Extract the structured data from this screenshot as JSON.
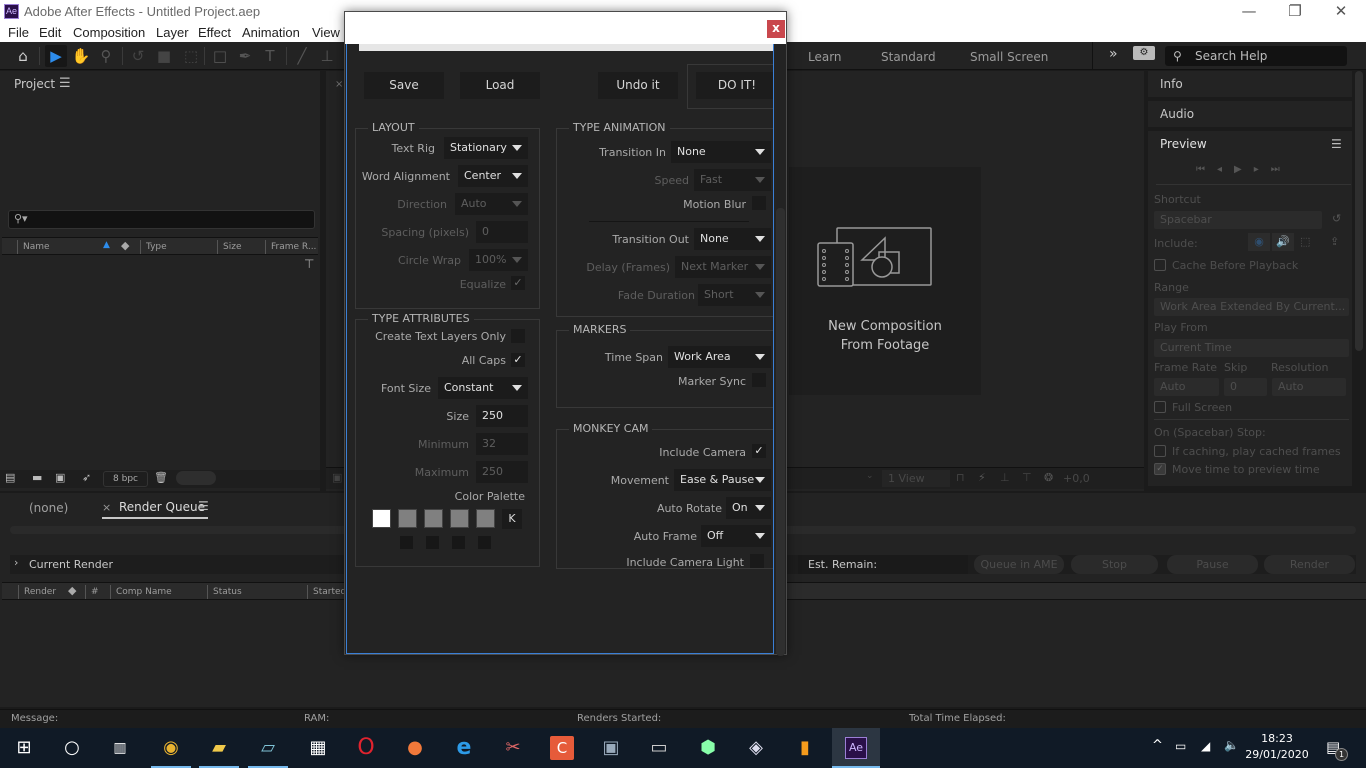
{
  "window": {
    "app_icon": "Ae",
    "title": "Adobe After Effects - Untitled Project.aep",
    "controls": {
      "minimize": "—",
      "restore": "❐",
      "close": "✕"
    }
  },
  "menu": [
    "File",
    "Edit",
    "Composition",
    "Layer",
    "Effect",
    "Animation",
    "View"
  ],
  "toolbar": {
    "tools": [
      "home-icon",
      "selection-icon",
      "hand-icon",
      "zoom-icon",
      "rotate-icon",
      "camera-icon",
      "pan-behind-icon",
      "rectangle-icon",
      "pen-icon",
      "type-icon",
      "brush-icon",
      "stamp-icon"
    ],
    "workspaces": [
      "Learn",
      "Standard",
      "Small Screen"
    ],
    "more": "»",
    "search_help": "Search Help"
  },
  "project_panel": {
    "title": "Project",
    "columns": [
      "Name",
      "Type",
      "Size",
      "Frame R..."
    ],
    "bpc": "8 bpc"
  },
  "composition_panel": {
    "new_comp_label_line1": "New Composition",
    "new_comp_label_line2": "From Footage",
    "view_select": "1 View",
    "exposure": "+0,0"
  },
  "right_panels": {
    "info": "Info",
    "audio": "Audio",
    "preview": {
      "title": "Preview",
      "shortcut_label": "Shortcut",
      "shortcut_value": "Spacebar",
      "include_label": "Include:",
      "cache_before_playback": "Cache Before Playback",
      "range_label": "Range",
      "range_value": "Work Area Extended By Current...",
      "play_from_label": "Play From",
      "play_from_value": "Current Time",
      "frame_rate_label": "Frame Rate",
      "frame_rate_value": "Auto",
      "skip_label": "Skip",
      "skip_value": "0",
      "resolution_label": "Resolution",
      "resolution_value": "Auto",
      "full_screen": "Full Screen",
      "on_stop_label": "On (Spacebar) Stop:",
      "if_caching": "If caching, play cached frames",
      "move_time": "Move time to preview time",
      "move_time_checked": true
    }
  },
  "render_queue": {
    "tab_none": "(none)",
    "tab_close": "×",
    "tab_title": "Render Queue",
    "current_render": "Current Render",
    "est_remain": "Est. Remain:",
    "buttons": [
      "Queue in AME",
      "Stop",
      "Pause",
      "Render"
    ],
    "columns": [
      "Render",
      "#",
      "Comp Name",
      "Status",
      "Started"
    ]
  },
  "status_bar": {
    "message": "Message:",
    "ram": "RAM:",
    "renders_started": "Renders Started:",
    "total_time": "Total Time Elapsed:"
  },
  "dialog": {
    "close": "x",
    "buttons": {
      "save": "Save",
      "load": "Load",
      "undo": "Undo it",
      "do_it": "DO IT!"
    },
    "layout": {
      "title": "LAYOUT",
      "text_rig_label": "Text Rig",
      "text_rig": "Stationary",
      "word_alignment_label": "Word Alignment",
      "word_alignment": "Center",
      "direction_label": "Direction",
      "direction": "Auto",
      "spacing_label": "Spacing (pixels)",
      "spacing": "0",
      "circle_wrap_label": "Circle Wrap",
      "circle_wrap": "100%",
      "equalize_label": "Equalize",
      "equalize": true
    },
    "type_attributes": {
      "title": "TYPE ATTRIBUTES",
      "create_text_layers_only_label": "Create Text Layers Only",
      "create_text_layers_only": false,
      "all_caps_label": "All Caps",
      "all_caps": true,
      "font_size_label": "Font Size",
      "font_size": "Constant",
      "size_label": "Size",
      "size": "250",
      "minimum_label": "Minimum",
      "minimum": "32",
      "maximum_label": "Maximum",
      "maximum": "250",
      "color_palette_label": "Color Palette",
      "palette": [
        "#ffffff",
        "#808080",
        "#808080",
        "#808080",
        "#808080"
      ],
      "palette_k": "K"
    },
    "type_animation": {
      "title": "TYPE ANIMATION",
      "transition_in_label": "Transition In",
      "transition_in": "None",
      "speed_label": "Speed",
      "speed": "Fast",
      "motion_blur_label": "Motion Blur",
      "motion_blur": false,
      "transition_out_label": "Transition Out",
      "transition_out": "None",
      "delay_label": "Delay (Frames)",
      "delay": "Next Marker",
      "fade_duration_label": "Fade Duration",
      "fade_duration": "Short"
    },
    "markers": {
      "title": "MARKERS",
      "time_span_label": "Time Span",
      "time_span": "Work Area",
      "marker_sync_label": "Marker Sync",
      "marker_sync": false
    },
    "monkey_cam": {
      "title": "MONKEY CAM",
      "include_camera_label": "Include Camera",
      "include_camera": true,
      "movement_label": "Movement",
      "movement": "Ease & Pause",
      "auto_rotate_label": "Auto Rotate",
      "auto_rotate": "On",
      "auto_frame_label": "Auto Frame",
      "auto_frame": "Off",
      "include_camera_light_label": "Include Camera Light",
      "include_camera_light": false
    }
  },
  "taskbar": {
    "apps": [
      "start-icon",
      "cortana-icon",
      "task-view-icon",
      "chrome-icon",
      "file-explorer-icon",
      "notes-icon",
      "calculator-icon",
      "opera-icon",
      "firefox-icon",
      "edge-icon",
      "snipping-icon",
      "camtasia-icon",
      "photos-icon",
      "monitor-icon",
      "nox-icon",
      "virtualbox-icon",
      "package-icon",
      "after-effects-icon"
    ],
    "ae_label": "Ae",
    "time": "18:23",
    "date": "29/01/2020",
    "notifications": "1"
  },
  "colors": {
    "accent": "#2d8ceb",
    "dialog_close": "#c9474d",
    "ae_purple": "#9b7fd6"
  }
}
